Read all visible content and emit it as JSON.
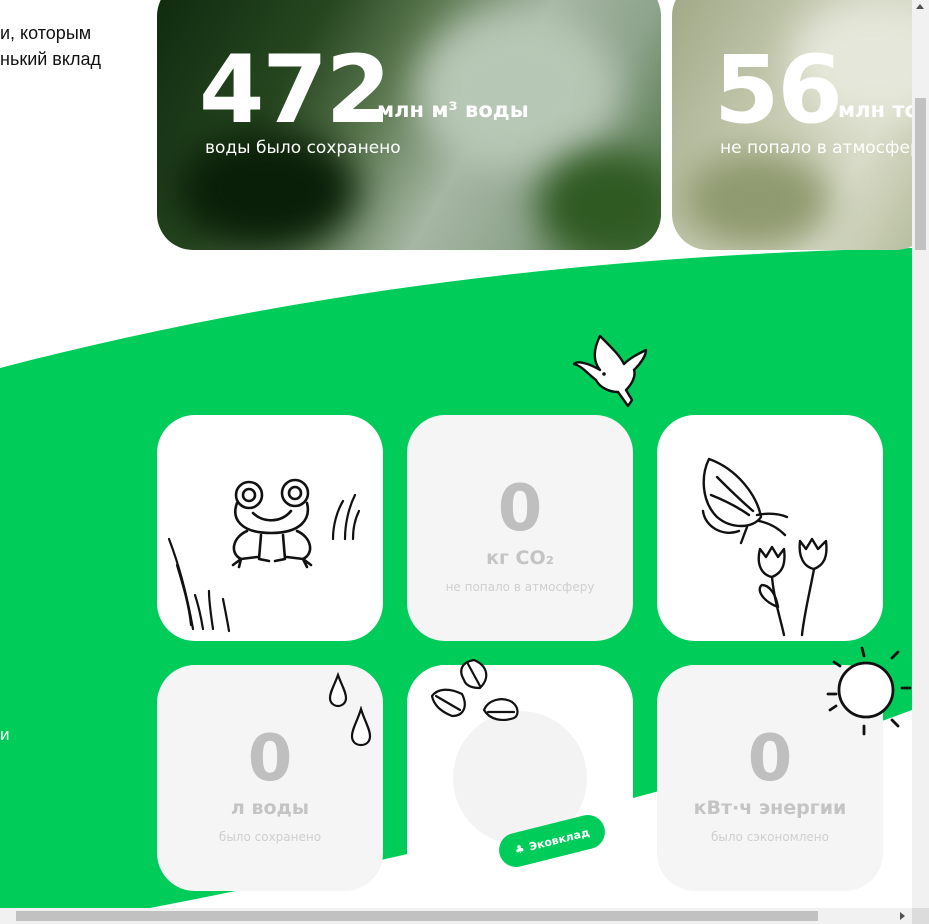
{
  "intro": {
    "line1": "и, которым",
    "line2": "нький вклад",
    "fragment": "и"
  },
  "stats": [
    {
      "number": "472",
      "unit": "млн м³ воды",
      "caption": "воды было сохранено"
    },
    {
      "number": "56",
      "unit": "млн тонн",
      "caption": "не попало в атмосферу"
    }
  ],
  "cards": {
    "co2": {
      "value": "0",
      "unit": "кг CO₂",
      "caption": "не попало в атмосферу"
    },
    "water": {
      "value": "0",
      "unit": "л воды",
      "caption": "было сохранено"
    },
    "energy": {
      "value": "0",
      "unit": "кВт·ч энергии",
      "caption": "было сэкономлено"
    }
  },
  "eco_button": {
    "label": "Эковклад",
    "icon": "plant-icon"
  },
  "colors": {
    "green": "#00CC5A",
    "card_gray": "#F5F5F5",
    "value_gray": "#BFBFBF"
  },
  "illustrations": [
    "bird-icon",
    "frog-icon",
    "grass-icon",
    "butterfly-icon",
    "flowers-icon",
    "raindrop-icon",
    "leaves-icon",
    "sun-icon"
  ]
}
